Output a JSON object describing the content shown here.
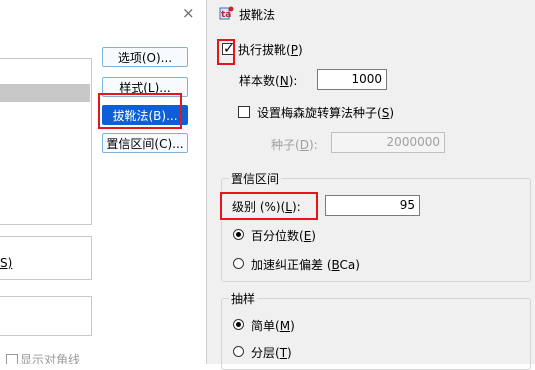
{
  "background_dialog": {
    "close_glyph": "×",
    "buttons": {
      "options": "选项(O)...",
      "style": "样式(L)...",
      "bootstrap": "拔靴法(B)...",
      "ci": "置信区间(C)..."
    },
    "partial_label_s": "S)",
    "show_diagonal": "显示对角线"
  },
  "dialog": {
    "title": "拔靴法",
    "perform": {
      "text": "执行拔靴",
      "mnemonic": "P",
      "checked": true
    },
    "samples": {
      "label": "样本数",
      "mnemonic": "N",
      "value": "1000"
    },
    "seed_check": {
      "label": "设置梅森旋转算法种子",
      "mnemonic": "S",
      "checked": false
    },
    "seed": {
      "label": "种子",
      "mnemonic": "D",
      "value": "2000000"
    },
    "ci_group": {
      "title": "置信区间",
      "level": {
        "label": "级别 (%)",
        "mnemonic": "L",
        "value": "95"
      },
      "percentile": {
        "label": "百分位数",
        "mnemonic": "E",
        "selected": true
      },
      "bca": {
        "label": "加速纠正偏差",
        "mnemonic": "B",
        "suffix": "Ca)",
        "selected": false
      }
    },
    "sampling_group": {
      "title": "抽样",
      "simple": {
        "label": "简单",
        "mnemonic": "M",
        "selected": true
      },
      "stratified": {
        "label": "分层",
        "mnemonic": "T",
        "selected": false
      }
    }
  },
  "colors": {
    "highlight_border": "#e8141c",
    "active_button": "#0d5fd6"
  }
}
